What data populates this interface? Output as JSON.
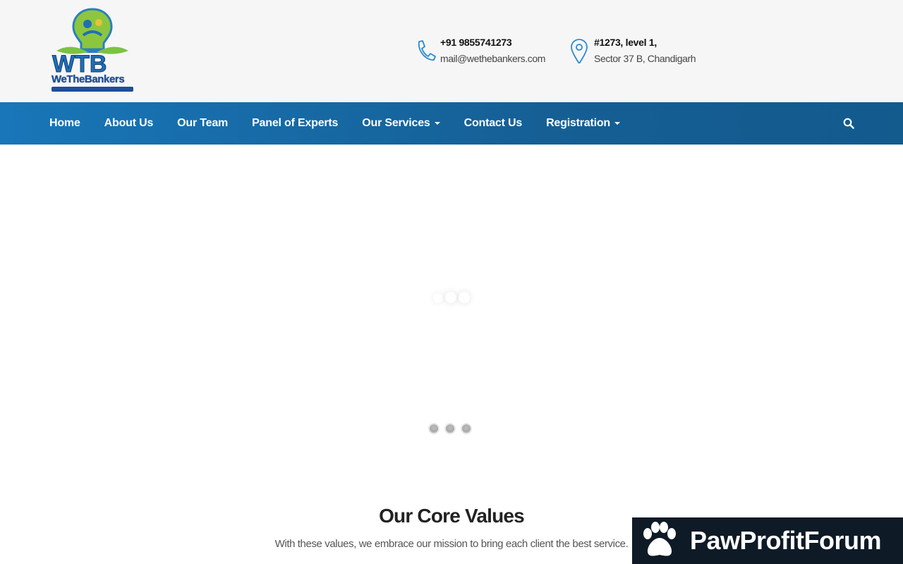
{
  "header": {
    "logo_text": "WeTheBankers",
    "phone": {
      "number": "+91 9855741273",
      "email": "mail@wethebankers.com"
    },
    "address": {
      "line1": "#1273, level 1,",
      "line2": "Sector 37 B, Chandigarh"
    }
  },
  "nav": {
    "items": [
      {
        "label": "Home",
        "dropdown": false
      },
      {
        "label": "About Us",
        "dropdown": false
      },
      {
        "label": "Our Team",
        "dropdown": false
      },
      {
        "label": "Panel of Experts",
        "dropdown": false
      },
      {
        "label": "Our Services",
        "dropdown": true
      },
      {
        "label": "Contact Us",
        "dropdown": false
      },
      {
        "label": "Registration",
        "dropdown": true
      }
    ],
    "search_icon": "search-icon"
  },
  "slider": {
    "dot_count": 3
  },
  "core_values": {
    "title": "Our Core Values",
    "subtitle": "With these values, we embrace our mission to bring each client the best service."
  },
  "watermark": {
    "text": "PawProfitForum"
  },
  "colors": {
    "nav_blue": "#1976b8",
    "accent_green": "#7cc242",
    "brand_blue": "#1f4e99",
    "watermark_bg": "#0e1a26"
  }
}
